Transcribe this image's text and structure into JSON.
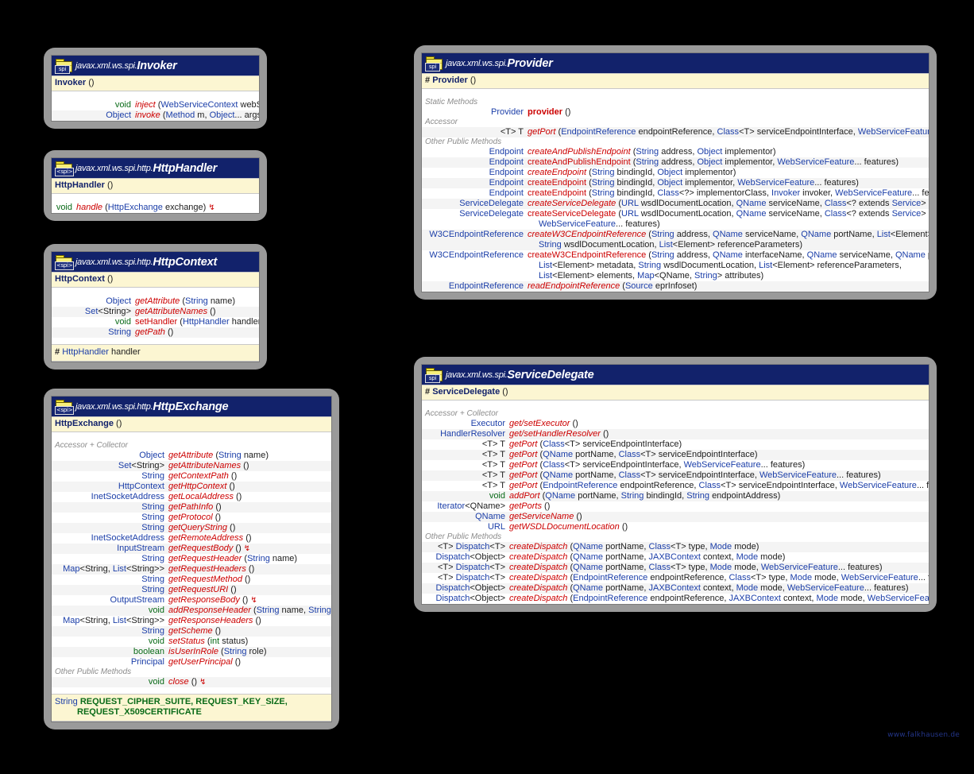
{
  "diagram": {
    "type": "uml-class-diagram",
    "background": "#000000",
    "watermark": "www.falkhausen.de",
    "colors": {
      "title_bar": "#12226b",
      "band": "#fcf6d2",
      "row_alt": "#f4f4f4",
      "frame": "#9a9a9a",
      "type": "#1b3ea8",
      "method": "#cc0000",
      "primitive": "#0a6b18",
      "group_label": "#8c8c8c"
    }
  },
  "classes": [
    {
      "id": "invoker",
      "icon": "package-spi-icon",
      "stereotype": "spi",
      "package": "javax.xml.ws.spi.",
      "name": "Invoker",
      "constructor": {
        "visibility": "",
        "label": "Invoker",
        "params": "()"
      },
      "sections": [
        {
          "group": "",
          "rows": [
            {
              "type": "void",
              "type_kind": "prim",
              "method": "inject",
              "method_kind": "abstract",
              "params": "(WebServiceContext webServiceContext)",
              "throws": true
            },
            {
              "type": "Object",
              "type_kind": "type",
              "method": "invoke",
              "method_kind": "abstract",
              "params": "(Method m, Object... args)",
              "throws": true
            }
          ]
        }
      ],
      "fields": []
    },
    {
      "id": "httphandler",
      "icon": "package-spi-interface-icon",
      "stereotype": "<spi>",
      "package": "javax.xml.ws.spi.http.",
      "name": "HttpHandler",
      "constructor": {
        "visibility": "",
        "label": "HttpHandler",
        "params": "()"
      },
      "sections": [
        {
          "group": "",
          "rows": [
            {
              "type": "void",
              "type_kind": "prim",
              "method": "handle",
              "method_kind": "abstract",
              "params": "(HttpExchange exchange)",
              "throws": true
            }
          ]
        }
      ],
      "fields": []
    },
    {
      "id": "httpcontext",
      "icon": "package-spi-interface-icon",
      "stereotype": "<spi>",
      "package": "javax.xml.ws.spi.http.",
      "name": "HttpContext",
      "constructor": {
        "visibility": "",
        "label": "HttpContext",
        "params": "()"
      },
      "sections": [
        {
          "group": "",
          "rows": [
            {
              "type": "Object",
              "type_kind": "type",
              "method": "getAttribute",
              "method_kind": "abstract",
              "params": "(String name)"
            },
            {
              "type": "Set<String>",
              "type_kind": "type",
              "method": "getAttributeNames",
              "method_kind": "abstract",
              "params": "()"
            },
            {
              "type": "void",
              "type_kind": "prim",
              "method": "setHandler",
              "method_kind": "plain",
              "params": "(HttpHandler handler)"
            },
            {
              "type": "String",
              "type_kind": "type",
              "method": "getPath",
              "method_kind": "abstract",
              "params": "()"
            }
          ]
        }
      ],
      "fields": [
        {
          "visibility": "#",
          "type": "HttpHandler",
          "name": "handler"
        }
      ]
    },
    {
      "id": "httpexchange",
      "icon": "package-spi-interface-icon",
      "stereotype": "<spi>",
      "package": "javax.xml.ws.spi.http.",
      "name": "HttpExchange",
      "constructor": {
        "visibility": "",
        "label": "HttpExchange",
        "params": "()"
      },
      "sections": [
        {
          "group": "Accessor + Collector",
          "rows": [
            {
              "type": "Object",
              "type_kind": "type",
              "method": "getAttribute",
              "method_kind": "abstract",
              "params": "(String name)"
            },
            {
              "type": "Set<String>",
              "type_kind": "type",
              "method": "getAttributeNames",
              "method_kind": "abstract",
              "params": "()"
            },
            {
              "type": "String",
              "type_kind": "type",
              "method": "getContextPath",
              "method_kind": "abstract",
              "params": "()"
            },
            {
              "type": "HttpContext",
              "type_kind": "type",
              "method": "getHttpContext",
              "method_kind": "abstract",
              "params": "()"
            },
            {
              "type": "InetSocketAddress",
              "type_kind": "type",
              "method": "getLocalAddress",
              "method_kind": "abstract",
              "params": "()"
            },
            {
              "type": "String",
              "type_kind": "type",
              "method": "getPathInfo",
              "method_kind": "abstract",
              "params": "()"
            },
            {
              "type": "String",
              "type_kind": "type",
              "method": "getProtocol",
              "method_kind": "abstract",
              "params": "()"
            },
            {
              "type": "String",
              "type_kind": "type",
              "method": "getQueryString",
              "method_kind": "abstract",
              "params": "()"
            },
            {
              "type": "InetSocketAddress",
              "type_kind": "type",
              "method": "getRemoteAddress",
              "method_kind": "abstract",
              "params": "()"
            },
            {
              "type": "InputStream",
              "type_kind": "type",
              "method": "getRequestBody",
              "method_kind": "abstract",
              "params": "()",
              "throws": true
            },
            {
              "type": "String",
              "type_kind": "type",
              "method": "getRequestHeader",
              "method_kind": "abstract",
              "params": "(String name)"
            },
            {
              "type": "Map<String, List<String>>",
              "type_kind": "type",
              "method": "getRequestHeaders",
              "method_kind": "abstract",
              "params": "()"
            },
            {
              "type": "String",
              "type_kind": "type",
              "method": "getRequestMethod",
              "method_kind": "abstract",
              "params": "()"
            },
            {
              "type": "String",
              "type_kind": "type",
              "method": "getRequestURI",
              "method_kind": "abstract",
              "params": "()"
            },
            {
              "type": "OutputStream",
              "type_kind": "type",
              "method": "getResponseBody",
              "method_kind": "abstract",
              "params": "()",
              "throws": true
            },
            {
              "type": "void",
              "type_kind": "prim",
              "method": "addResponseHeader",
              "method_kind": "abstract",
              "params": "(String name, String value)"
            },
            {
              "type": "Map<String, List<String>>",
              "type_kind": "type",
              "method": "getResponseHeaders",
              "method_kind": "abstract",
              "params": "()"
            },
            {
              "type": "String",
              "type_kind": "type",
              "method": "getScheme",
              "method_kind": "abstract",
              "params": "()"
            },
            {
              "type": "void",
              "type_kind": "prim",
              "method": "setStatus",
              "method_kind": "abstract",
              "params": "(int status)"
            },
            {
              "type": "boolean",
              "type_kind": "prim",
              "method": "isUserInRole",
              "method_kind": "abstract",
              "params": "(String role)"
            },
            {
              "type": "Principal",
              "type_kind": "type",
              "method": "getUserPrincipal",
              "method_kind": "abstract",
              "params": "()"
            }
          ]
        },
        {
          "group": "Other Public Methods",
          "rows": [
            {
              "type": "void",
              "type_kind": "prim",
              "method": "close",
              "method_kind": "abstract",
              "params": "()",
              "throws": true
            }
          ]
        }
      ],
      "fields": [
        {
          "visibility": "",
          "type": "String",
          "name": "REQUEST_CIPHER_SUITE, REQUEST_KEY_SIZE,",
          "name2": "REQUEST_X509CERTIFICATE",
          "constant": true
        }
      ]
    },
    {
      "id": "provider",
      "icon": "package-spi-icon",
      "stereotype": "spi",
      "package": "javax.xml.ws.spi.",
      "name": "Provider",
      "constructor": {
        "visibility": "#",
        "label": "Provider",
        "params": "()"
      },
      "sections": [
        {
          "group": "Static Methods",
          "rows": [
            {
              "type": "Provider",
              "type_kind": "type",
              "method": "provider",
              "method_kind": "bold",
              "params": "()"
            }
          ]
        },
        {
          "group": "Accessor",
          "rows": [
            {
              "type": "<T> T",
              "type_kind": "generic",
              "method": "getPort",
              "method_kind": "abstract",
              "params": "(EndpointReference endpointReference, Class<T> serviceEndpointInterface, WebServiceFeature... features)"
            }
          ]
        },
        {
          "group": "Other Public Methods",
          "rows": [
            {
              "type": "Endpoint",
              "type_kind": "type",
              "method": "createAndPublishEndpoint",
              "method_kind": "abstract",
              "params": "(String address, Object implementor)"
            },
            {
              "type": "Endpoint",
              "type_kind": "type",
              "method": "createAndPublishEndpoint",
              "method_kind": "plain",
              "params": "(String address, Object implementor, WebServiceFeature... features)"
            },
            {
              "type": "Endpoint",
              "type_kind": "type",
              "method": "createEndpoint",
              "method_kind": "abstract",
              "params": "(String bindingId, Object implementor)"
            },
            {
              "type": "Endpoint",
              "type_kind": "type",
              "method": "createEndpoint",
              "method_kind": "plain",
              "params": "(String bindingId, Object implementor, WebServiceFeature... features)"
            },
            {
              "type": "Endpoint",
              "type_kind": "type",
              "method": "createEndpoint",
              "method_kind": "plain",
              "params": "(String bindingId, Class<?> implementorClass, Invoker invoker, WebServiceFeature... features)"
            },
            {
              "type": "ServiceDelegate",
              "type_kind": "type",
              "method": "createServiceDelegate",
              "method_kind": "abstract",
              "params": "(URL wsdlDocumentLocation, QName serviceName, Class<? extends Service> serviceClass)"
            },
            {
              "type": "ServiceDelegate",
              "type_kind": "type",
              "method": "createServiceDelegate",
              "method_kind": "plain",
              "params": "(URL wsdlDocumentLocation, QName serviceName, Class<? extends Service> serviceClass,",
              "cont": "WebServiceFeature... features)"
            },
            {
              "type": "W3CEndpointReference",
              "type_kind": "type",
              "method": "createW3CEndpointReference",
              "method_kind": "abstract",
              "params": "(String address, QName serviceName, QName portName, List<Element> metadata,",
              "cont": "String wsdlDocumentLocation, List<Element> referenceParameters)"
            },
            {
              "type": "W3CEndpointReference",
              "type_kind": "type",
              "method": "createW3CEndpointReference",
              "method_kind": "plain",
              "params": "(String address, QName interfaceName, QName serviceName, QName portName,",
              "cont": "List<Element> metadata, String wsdlDocumentLocation, List<Element> referenceParameters,",
              "cont2": "List<Element> elements, Map<QName, String> attributes)"
            },
            {
              "type": "EndpointReference",
              "type_kind": "type",
              "method": "readEndpointReference",
              "method_kind": "abstract",
              "params": "(Source eprInfoset)"
            }
          ]
        }
      ],
      "fields": []
    },
    {
      "id": "servicedelegate",
      "icon": "package-spi-icon",
      "stereotype": "spi",
      "package": "javax.xml.ws.spi.",
      "name": "ServiceDelegate",
      "constructor": {
        "visibility": "#",
        "label": "ServiceDelegate",
        "params": "()"
      },
      "sections": [
        {
          "group": "Accessor + Collector",
          "rows": [
            {
              "type": "Executor",
              "type_kind": "type",
              "method": "get/setExecutor",
              "method_kind": "abstract",
              "params": "()"
            },
            {
              "type": "HandlerResolver",
              "type_kind": "type",
              "method": "get/setHandlerResolver",
              "method_kind": "abstract",
              "params": "()"
            },
            {
              "type": "<T> T",
              "type_kind": "generic",
              "method": "getPort",
              "method_kind": "abstract",
              "params": "(Class<T> serviceEndpointInterface)"
            },
            {
              "type": "<T> T",
              "type_kind": "generic",
              "method": "getPort",
              "method_kind": "abstract",
              "params": "(QName portName, Class<T> serviceEndpointInterface)"
            },
            {
              "type": "<T> T",
              "type_kind": "generic",
              "method": "getPort",
              "method_kind": "abstract",
              "params": "(Class<T> serviceEndpointInterface, WebServiceFeature... features)"
            },
            {
              "type": "<T> T",
              "type_kind": "generic",
              "method": "getPort",
              "method_kind": "abstract",
              "params": "(QName portName, Class<T> serviceEndpointInterface, WebServiceFeature... features)"
            },
            {
              "type": "<T> T",
              "type_kind": "generic",
              "method": "getPort",
              "method_kind": "abstract",
              "params": "(EndpointReference endpointReference, Class<T> serviceEndpointInterface, WebServiceFeature... features)"
            },
            {
              "type": "void",
              "type_kind": "prim",
              "method": "addPort",
              "method_kind": "abstract",
              "params": "(QName portName, String bindingId, String endpointAddress)"
            },
            {
              "type": "Iterator<QName>",
              "type_kind": "type",
              "method": "getPorts",
              "method_kind": "abstract",
              "params": "()"
            },
            {
              "type": "QName",
              "type_kind": "type",
              "method": "getServiceName",
              "method_kind": "abstract",
              "params": "()"
            },
            {
              "type": "URL",
              "type_kind": "type",
              "method": "getWSDLDocumentLocation",
              "method_kind": "abstract",
              "params": "()"
            }
          ]
        },
        {
          "group": "Other Public Methods",
          "rows": [
            {
              "type": "<T> Dispatch<T>",
              "type_kind": "generic",
              "method": "createDispatch",
              "method_kind": "abstract",
              "params": "(QName portName, Class<T> type, Mode mode)"
            },
            {
              "type": "Dispatch<Object>",
              "type_kind": "type",
              "method": "createDispatch",
              "method_kind": "abstract",
              "params": "(QName portName, JAXBContext context, Mode mode)"
            },
            {
              "type": "<T> Dispatch<T>",
              "type_kind": "generic",
              "method": "createDispatch",
              "method_kind": "abstract",
              "params": "(QName portName, Class<T> type, Mode mode, WebServiceFeature... features)"
            },
            {
              "type": "<T> Dispatch<T>",
              "type_kind": "generic",
              "method": "createDispatch",
              "method_kind": "abstract",
              "params": "(EndpointReference endpointReference, Class<T> type, Mode mode, WebServiceFeature... features)"
            },
            {
              "type": "Dispatch<Object>",
              "type_kind": "type",
              "method": "createDispatch",
              "method_kind": "abstract",
              "params": "(QName portName, JAXBContext context, Mode mode, WebServiceFeature... features)"
            },
            {
              "type": "Dispatch<Object>",
              "type_kind": "type",
              "method": "createDispatch",
              "method_kind": "abstract",
              "params": "(EndpointReference endpointReference, JAXBContext context, Mode mode, WebServiceFeature... features)"
            }
          ]
        }
      ],
      "fields": []
    }
  ]
}
